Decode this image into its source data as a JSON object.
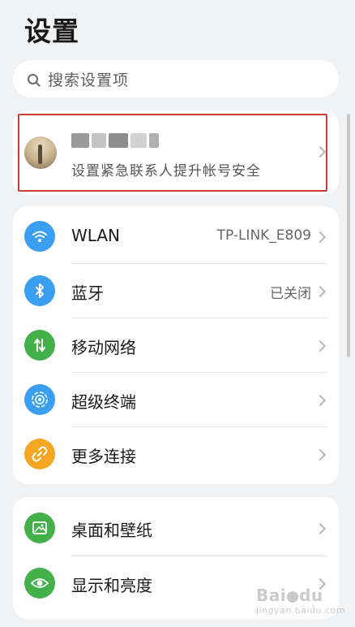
{
  "page": {
    "title": "设置"
  },
  "search": {
    "placeholder": "搜索设置项"
  },
  "account": {
    "subtitle": "设置紧急联系人提升帐号安全"
  },
  "connectivity": [
    {
      "name": "wlan",
      "label": "WLAN",
      "value": "TP-LINK_E809",
      "icon": "wifi-icon",
      "color": "#3a9ff0"
    },
    {
      "name": "bluetooth",
      "label": "蓝牙",
      "value": "已关闭",
      "icon": "bluetooth-icon",
      "color": "#3a9ff0"
    },
    {
      "name": "mobile-network",
      "label": "移动网络",
      "value": "",
      "icon": "mobile-data-icon",
      "color": "#43b04a"
    },
    {
      "name": "super-device",
      "label": "超级终端",
      "value": "",
      "icon": "super-device-icon",
      "color": "#3a9ff0"
    },
    {
      "name": "more-connections",
      "label": "更多连接",
      "value": "",
      "icon": "link-icon",
      "color": "#f5a623"
    }
  ],
  "display": [
    {
      "name": "home-wallpaper",
      "label": "桌面和壁纸",
      "value": "",
      "icon": "wallpaper-icon",
      "color": "#43b04a"
    },
    {
      "name": "display-brightness",
      "label": "显示和亮度",
      "value": "",
      "icon": "eye-icon",
      "color": "#43b04a"
    }
  ],
  "watermark": {
    "text": "Bai",
    "text2": "du",
    "sub": "jingyan.baidu.com"
  }
}
